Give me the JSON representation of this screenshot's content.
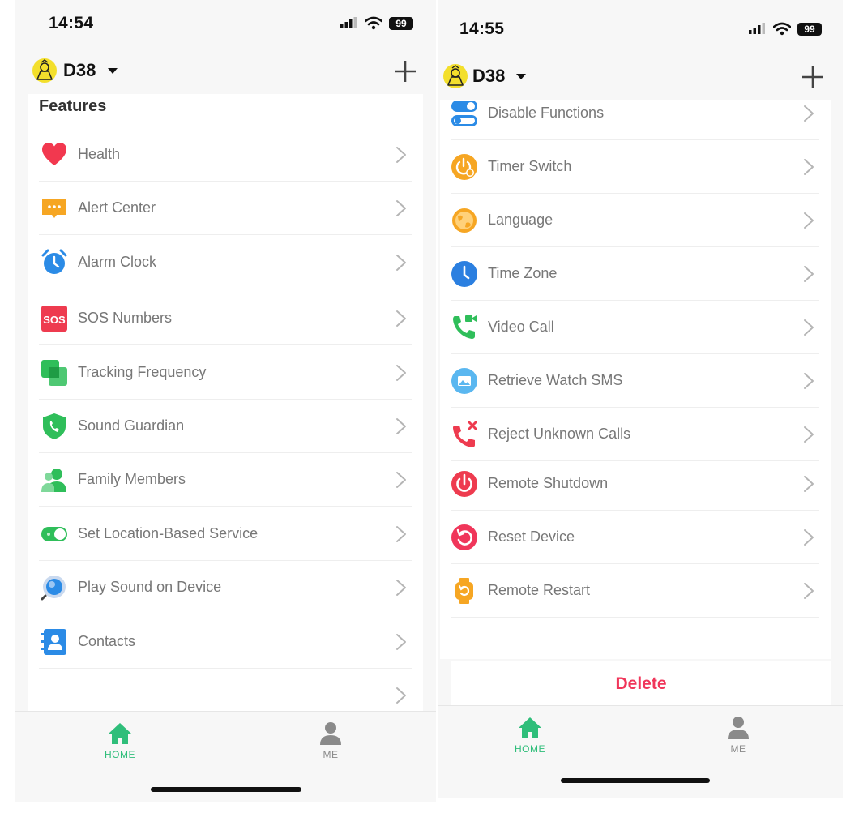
{
  "left_screen": {
    "status": {
      "time": "14:54",
      "battery": "99"
    },
    "header": {
      "device_name": "D38"
    },
    "section_title": "Features",
    "items": [
      {
        "label": "Health",
        "icon": "heart-icon",
        "color": "#f2384f"
      },
      {
        "label": "Alert Center",
        "icon": "message-icon",
        "color": "#f6a623"
      },
      {
        "label": "Alarm Clock",
        "icon": "alarm-clock-icon",
        "color": "#2b8be6"
      },
      {
        "label": "SOS Numbers",
        "icon": "sos-icon",
        "color": "#ee3b4f"
      },
      {
        "label": "Tracking Frequency",
        "icon": "tracking-icon",
        "color": "#2fbe5a"
      },
      {
        "label": "Sound Guardian",
        "icon": "shield-phone-icon",
        "color": "#2fbe5a"
      },
      {
        "label": "Family Members",
        "icon": "family-icon",
        "color": "#2fbe5a"
      },
      {
        "label": "Set Location-Based Service",
        "icon": "toggle-icon",
        "color": "#2fbe5a"
      },
      {
        "label": "Play Sound on Device",
        "icon": "search-sound-icon",
        "color": "#2b8be6"
      },
      {
        "label": "Contacts",
        "icon": "contacts-icon",
        "color": "#2b8be6"
      },
      {
        "label": "",
        "icon": "",
        "color": ""
      }
    ],
    "tabs": [
      {
        "label": "HOME",
        "icon": "home-icon",
        "color": "#2fbe7a"
      },
      {
        "label": "ME",
        "icon": "person-icon",
        "color": "#8a8a8a"
      }
    ]
  },
  "right_screen": {
    "status": {
      "time": "14:55",
      "battery": "99"
    },
    "header": {
      "device_name": "D38"
    },
    "items": [
      {
        "label": "Disable Functions",
        "icon": "toggles-icon",
        "color": "#2b8be6"
      },
      {
        "label": "Timer Switch",
        "icon": "timer-power-icon",
        "color": "#f6a623"
      },
      {
        "label": "Language",
        "icon": "globe-icon",
        "color": "#f6a623"
      },
      {
        "label": "Time Zone",
        "icon": "clock-icon",
        "color": "#2b7fe0"
      },
      {
        "label": "Video Call",
        "icon": "video-call-icon",
        "color": "#2fbe5a"
      },
      {
        "label": "Retrieve Watch SMS",
        "icon": "image-sms-icon",
        "color": "#5ab7f0"
      },
      {
        "label": "Reject Unknown Calls",
        "icon": "reject-call-icon",
        "color": "#ee3b4f"
      },
      {
        "label": "Remote Shutdown",
        "icon": "power-icon",
        "color": "#ee3b4f"
      },
      {
        "label": "Reset Device",
        "icon": "reset-icon",
        "color": "#f0365a"
      },
      {
        "label": "Remote Restart",
        "icon": "watch-restart-icon",
        "color": "#f6a623"
      }
    ],
    "delete_label": "Delete",
    "tabs": [
      {
        "label": "HOME",
        "icon": "home-icon",
        "color": "#2fbe7a"
      },
      {
        "label": "ME",
        "icon": "person-icon",
        "color": "#8a8a8a"
      }
    ]
  }
}
